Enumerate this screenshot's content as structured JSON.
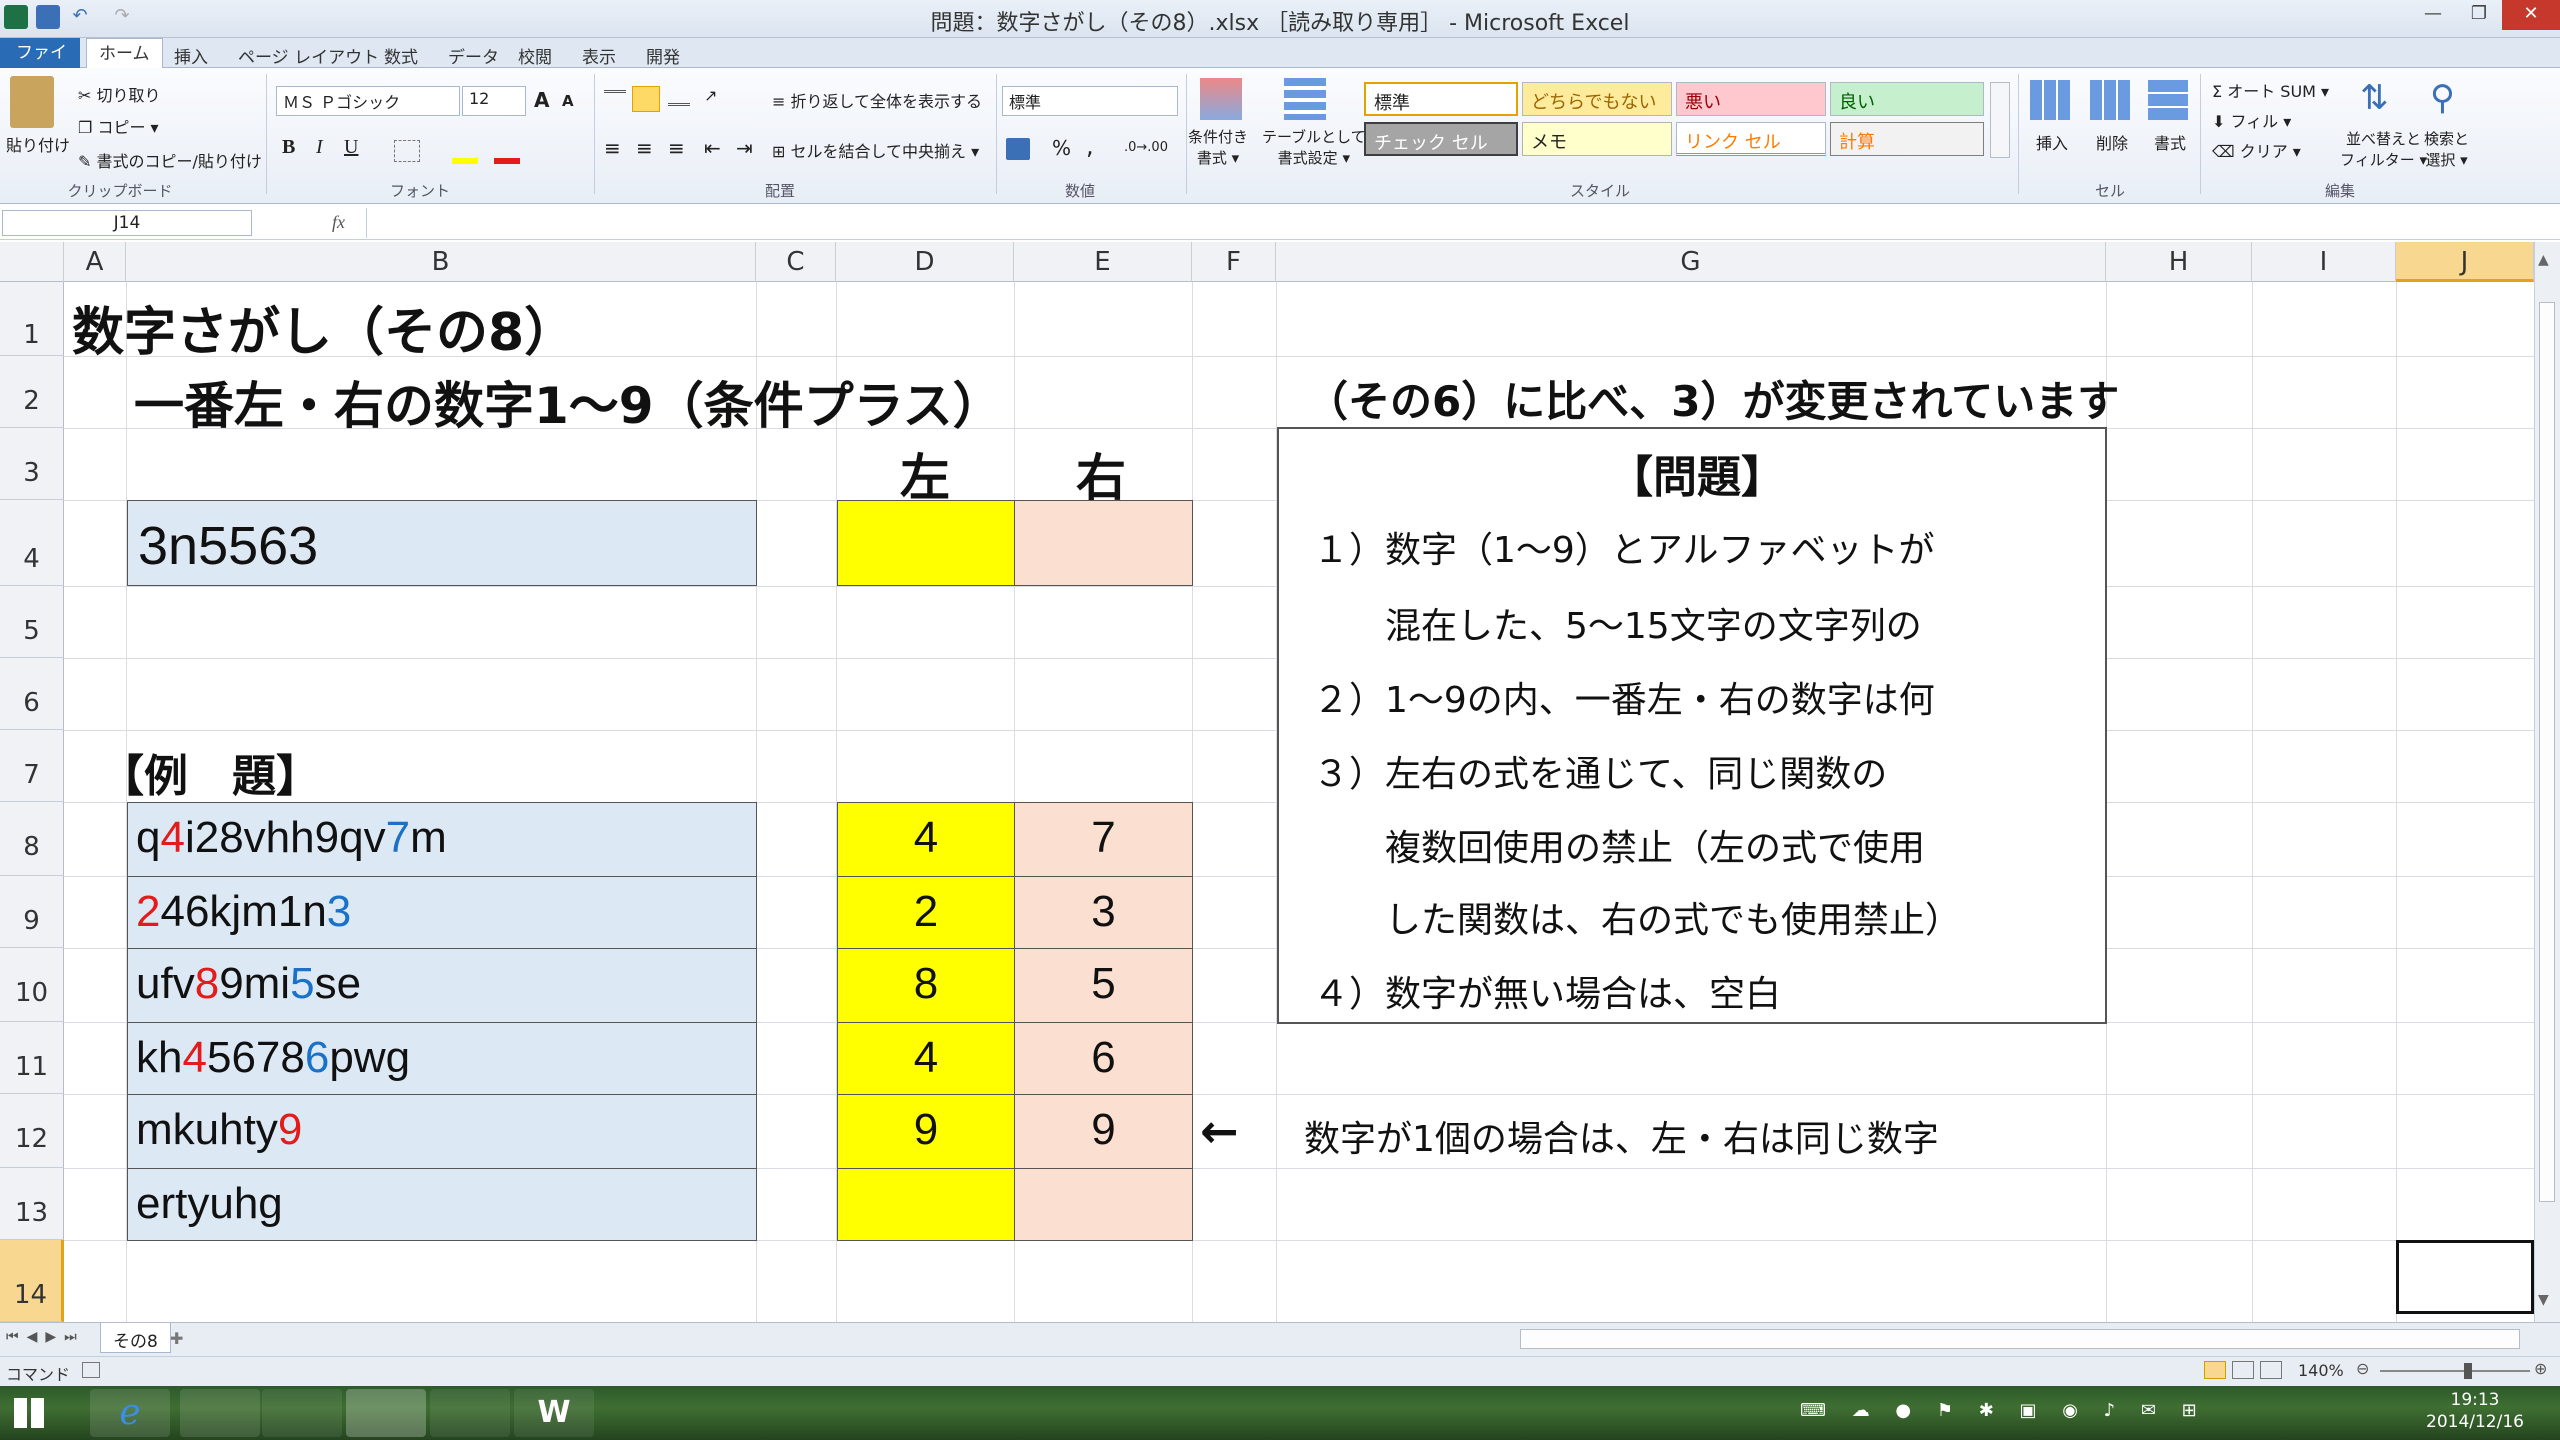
{
  "window": {
    "title": "問題：数字さがし（その8）.xlsx ［読み取り専用］ - Microsoft Excel",
    "minimize": "—",
    "maximize": "❐",
    "close": "✕"
  },
  "menu": {
    "file": "ファイル",
    "tabs": [
      "ホーム",
      "挿入",
      "ページ レイアウト",
      "数式",
      "データ",
      "校閲",
      "表示",
      "開発"
    ]
  },
  "ribbon": {
    "clipboard": {
      "paste": "貼り付け",
      "cut": "切り取り",
      "copy": "コピー ▾",
      "format_painter": "書式のコピー/貼り付け",
      "label": "クリップボード"
    },
    "font": {
      "name": "ＭＳ Ｐゴシック",
      "size": "12",
      "bold": "B",
      "italic": "I",
      "underline": "U",
      "grow": "A",
      "shrink": "A",
      "label": "フォント"
    },
    "alignment": {
      "wrap": "折り返して全体を表示する",
      "merge": "セルを結合して中央揃え ▾",
      "label": "配置"
    },
    "number": {
      "format": "標準",
      "percent": "%",
      "comma": ",",
      "label": "数値"
    },
    "styles": {
      "conditional": "条件付き\n書式 ▾",
      "table": "テーブルとして\n書式設定 ▾",
      "cells": [
        "標準",
        "どちらでもない",
        "悪い",
        "良い",
        "チェック セル",
        "メモ",
        "リンク セル",
        "計算"
      ],
      "label": "スタイル"
    },
    "cells_group": {
      "insert": "挿入",
      "delete": "削除",
      "format": "書式",
      "label": "セル"
    },
    "editing": {
      "autosum": "Σ オート SUM ▾",
      "fill": "フィル ▾",
      "clear": "クリア ▾",
      "sort": "並べ替えと\nフィルター ▾",
      "find": "検索と\n選択 ▾",
      "label": "編集"
    }
  },
  "formula_bar": {
    "name_box": "J14",
    "fx": "fx",
    "value": ""
  },
  "columns": [
    "A",
    "B",
    "C",
    "D",
    "E",
    "F",
    "G",
    "H",
    "I",
    "J"
  ],
  "rows": [
    "1",
    "2",
    "3",
    "4",
    "5",
    "6",
    "7",
    "8",
    "9",
    "10",
    "11",
    "12",
    "13",
    "14"
  ],
  "sheet": {
    "title": "数字さがし（その8）",
    "subtitle": "一番左・右の数字1～9（条件プラス）",
    "note_change": "（その6）に比べ、3）が変更されています",
    "header_left": "左",
    "header_right": "右",
    "question_input": "3n5563",
    "example_label": "【例　題】",
    "examples": [
      {
        "parts": [
          {
            "t": "q"
          },
          {
            "t": "4",
            "c": "r"
          },
          {
            "t": "i28vhh9qv"
          },
          {
            "t": "7",
            "c": "b"
          },
          {
            "t": "m"
          }
        ],
        "left": "4",
        "right": "7"
      },
      {
        "parts": [
          {
            "t": "2",
            "c": "r"
          },
          {
            "t": "46kjm1n"
          },
          {
            "t": "3",
            "c": "b"
          }
        ],
        "left": "2",
        "right": "3"
      },
      {
        "parts": [
          {
            "t": "ufv"
          },
          {
            "t": "8",
            "c": "r"
          },
          {
            "t": "9mi"
          },
          {
            "t": "5",
            "c": "b"
          },
          {
            "t": "se"
          }
        ],
        "left": "8",
        "right": "5"
      },
      {
        "parts": [
          {
            "t": "kh"
          },
          {
            "t": "4",
            "c": "r"
          },
          {
            "t": "5678"
          },
          {
            "t": "6",
            "c": "b"
          },
          {
            "t": "pwg"
          }
        ],
        "left": "4",
        "right": "6"
      },
      {
        "parts": [
          {
            "t": "mkuhty"
          },
          {
            "t": "9",
            "c": "r"
          }
        ],
        "left": "9",
        "right": "9"
      },
      {
        "parts": [
          {
            "t": "ertyuhg"
          }
        ],
        "left": "",
        "right": ""
      }
    ],
    "problem": {
      "heading": "【問題】",
      "lines": [
        {
          "text": "１）数字（1～9）とアルファベットが",
          "red": false
        },
        {
          "text": "　　混在した、5～15文字の文字列の",
          "red": false
        },
        {
          "text": "２）1～9の内、一番左・右の数字は何",
          "red": false
        },
        {
          "text": "３）左右の式を通じて、同じ関数の",
          "red": true
        },
        {
          "text": "　　複数回使用の禁止（左の式で使用",
          "red": true
        },
        {
          "text": "　　した関数は、右の式でも使用禁止）",
          "red": true
        },
        {
          "text": "４）数字が無い場合は、空白",
          "red": false
        }
      ]
    },
    "arrow": "←",
    "arrow_note": "数字が1個の場合は、左・右は同じ数字"
  },
  "sheet_tabs": {
    "active": "その8"
  },
  "status": {
    "mode": "コマンド",
    "zoom": "140%"
  },
  "taskbar": {
    "time": "19:13",
    "date": "2014/12/16"
  },
  "colors": {
    "yellow": "#ffff00",
    "pink": "#fbe0d2",
    "blue_cell": "#dce9f5",
    "red": "#e31b1b",
    "blue": "#1a72c8"
  }
}
